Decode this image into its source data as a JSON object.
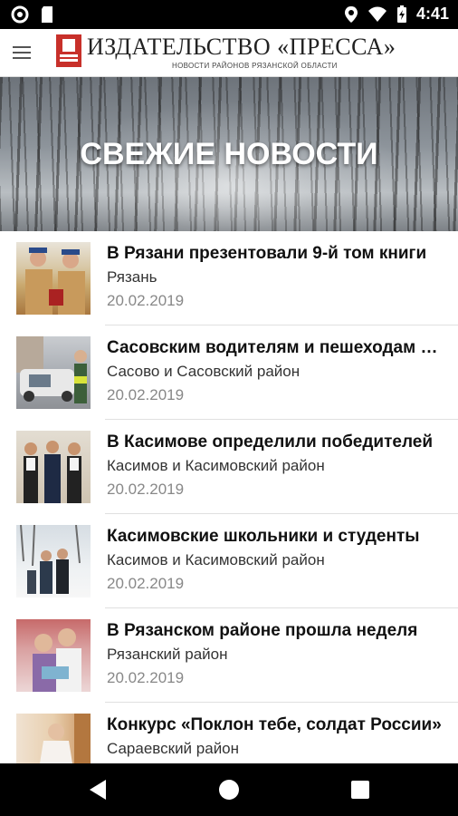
{
  "status_bar": {
    "time": "4:41",
    "left_icons": [
      "circle-notification-icon",
      "sd-card-icon"
    ],
    "right_icons": [
      "location-icon",
      "wifi-icon",
      "battery-charging-icon"
    ]
  },
  "app_bar": {
    "menu_icon": "hamburger-menu-icon",
    "logo_title": "ИЗДАТЕЛЬСТВО «ПРЕССА»",
    "logo_subtitle": "НОВОСТИ РАЙОНОВ РЯЗАНСКОЙ ОБЛАСТИ"
  },
  "hero": {
    "title": "СВЕЖИЕ НОВОСТИ"
  },
  "news": [
    {
      "title": "В Рязани презентовали 9-й том книги",
      "region": "Рязань",
      "date": "20.02.2019"
    },
    {
      "title": "Сасовским водителям и пешеходам напомнили",
      "region": "Сасово и Сасовский район",
      "date": "20.02.2019"
    },
    {
      "title": "В Касимове определили победителей",
      "region": "Касимов и Касимовский район",
      "date": "20.02.2019"
    },
    {
      "title": "Касимовские школьники и студенты",
      "region": "Касимов и Касимовский район",
      "date": "20.02.2019"
    },
    {
      "title": "В Рязанском районе прошла неделя",
      "region": "Рязанский район",
      "date": "20.02.2019"
    },
    {
      "title": "Конкурс «Поклон тебе, солдат России»",
      "region": "Сараевский район",
      "date": ""
    }
  ],
  "colors": {
    "brand_red": "#c8302a",
    "status_bar": "#000000",
    "nav_bar": "#000000",
    "divider": "#e0e0e0"
  },
  "nav_bar": {
    "back_icon": "back-triangle-icon",
    "home_icon": "home-circle-icon",
    "recent_icon": "recent-apps-square-icon"
  }
}
